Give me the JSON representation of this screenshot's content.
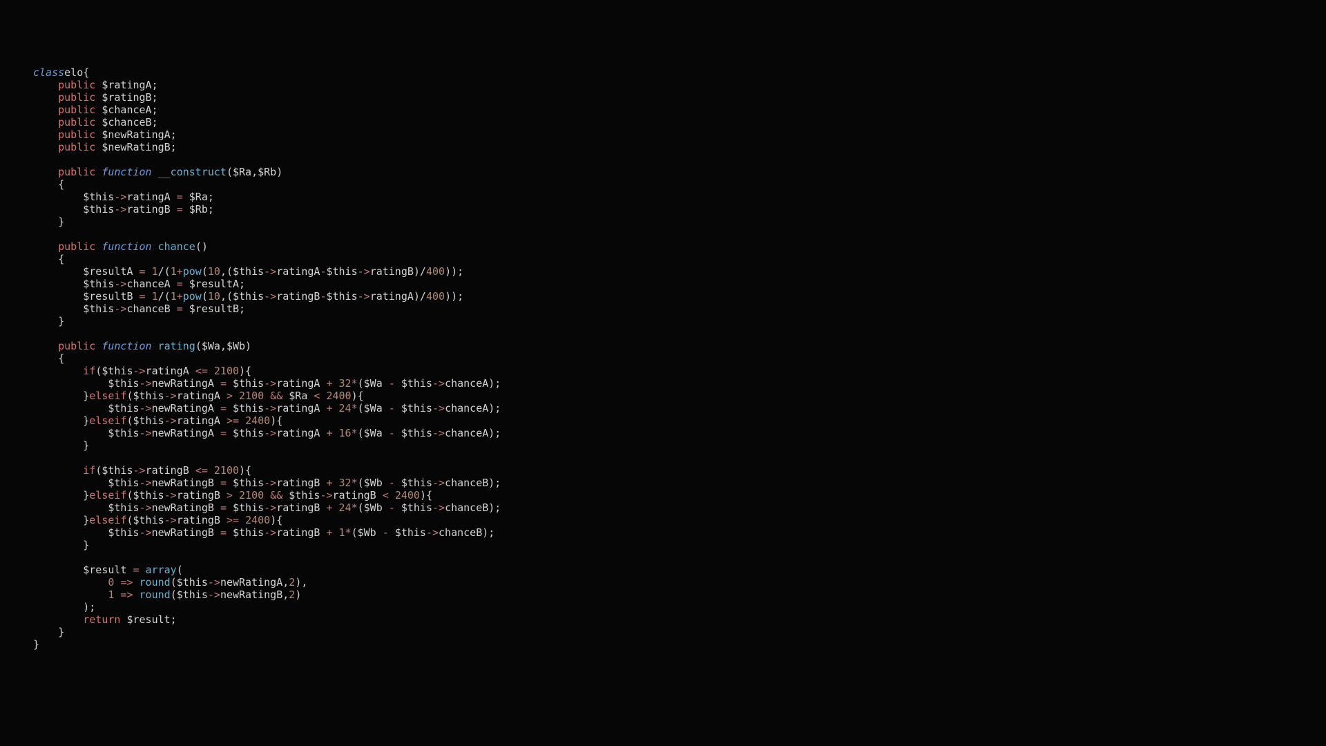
{
  "code_lines": [
    [
      [
        "it",
        "class"
      ],
      [
        "",
        ""
      ],
      [
        "",
        "elo{"
      ]
    ],
    [
      [
        "",
        "    "
      ],
      [
        "kw",
        "public"
      ],
      [
        "",
        " $ratingA;"
      ]
    ],
    [
      [
        "",
        "    "
      ],
      [
        "kw",
        "public"
      ],
      [
        "",
        " $ratingB;"
      ]
    ],
    [
      [
        "",
        "    "
      ],
      [
        "kw",
        "public"
      ],
      [
        "",
        " $chanceA;"
      ]
    ],
    [
      [
        "",
        "    "
      ],
      [
        "kw",
        "public"
      ],
      [
        "",
        " $chanceB;"
      ]
    ],
    [
      [
        "",
        "    "
      ],
      [
        "kw",
        "public"
      ],
      [
        "",
        " $newRatingA;"
      ]
    ],
    [
      [
        "",
        "    "
      ],
      [
        "kw",
        "public"
      ],
      [
        "",
        " $newRatingB;"
      ]
    ],
    [
      [
        "",
        ""
      ]
    ],
    [
      [
        "",
        "    "
      ],
      [
        "kw",
        "public"
      ],
      [
        "",
        " "
      ],
      [
        "it",
        "function"
      ],
      [
        "",
        " "
      ],
      [
        "fn",
        "__construct"
      ],
      [
        "",
        "($Ra,$Rb)"
      ]
    ],
    [
      [
        "",
        "    {"
      ]
    ],
    [
      [
        "",
        "        $this"
      ],
      [
        "op",
        "->"
      ],
      [
        "",
        "ratingA "
      ],
      [
        "op",
        "="
      ],
      [
        "",
        " $Ra;"
      ]
    ],
    [
      [
        "",
        "        $this"
      ],
      [
        "op",
        "->"
      ],
      [
        "",
        "ratingB "
      ],
      [
        "op",
        "="
      ],
      [
        "",
        " $Rb;"
      ]
    ],
    [
      [
        "",
        "    }"
      ]
    ],
    [
      [
        "",
        ""
      ]
    ],
    [
      [
        "",
        "    "
      ],
      [
        "kw",
        "public"
      ],
      [
        "",
        " "
      ],
      [
        "it",
        "function"
      ],
      [
        "",
        " "
      ],
      [
        "fn",
        "chance"
      ],
      [
        "",
        "()"
      ]
    ],
    [
      [
        "",
        "    {"
      ]
    ],
    [
      [
        "",
        "        $resultA "
      ],
      [
        "op",
        "="
      ],
      [
        "",
        " "
      ],
      [
        "num",
        "1"
      ],
      [
        "",
        "/("
      ],
      [
        "num",
        "1"
      ],
      [
        "op",
        "+"
      ],
      [
        "fn",
        "pow"
      ],
      [
        "",
        "("
      ],
      [
        "num",
        "10"
      ],
      [
        "",
        ",($this"
      ],
      [
        "op",
        "->"
      ],
      [
        "",
        "ratingA"
      ],
      [
        "op",
        "-"
      ],
      [
        "",
        "$this"
      ],
      [
        "op",
        "->"
      ],
      [
        "",
        "ratingB)/"
      ],
      [
        "num",
        "400"
      ],
      [
        "",
        "));"
      ]
    ],
    [
      [
        "",
        "        $this"
      ],
      [
        "op",
        "->"
      ],
      [
        "",
        "chanceA "
      ],
      [
        "op",
        "="
      ],
      [
        "",
        " $resultA;"
      ]
    ],
    [
      [
        "",
        "        $resultB "
      ],
      [
        "op",
        "="
      ],
      [
        "",
        " "
      ],
      [
        "num",
        "1"
      ],
      [
        "",
        "/("
      ],
      [
        "num",
        "1"
      ],
      [
        "op",
        "+"
      ],
      [
        "fn",
        "pow"
      ],
      [
        "",
        "("
      ],
      [
        "num",
        "10"
      ],
      [
        "",
        ",($this"
      ],
      [
        "op",
        "->"
      ],
      [
        "",
        "ratingB"
      ],
      [
        "op",
        "-"
      ],
      [
        "",
        "$this"
      ],
      [
        "op",
        "->"
      ],
      [
        "",
        "ratingA)/"
      ],
      [
        "num",
        "400"
      ],
      [
        "",
        "));"
      ]
    ],
    [
      [
        "",
        "        $this"
      ],
      [
        "op",
        "->"
      ],
      [
        "",
        "chanceB "
      ],
      [
        "op",
        "="
      ],
      [
        "",
        " $resultB;"
      ]
    ],
    [
      [
        "",
        "    }"
      ]
    ],
    [
      [
        "",
        ""
      ]
    ],
    [
      [
        "",
        "    "
      ],
      [
        "kw",
        "public"
      ],
      [
        "",
        " "
      ],
      [
        "it",
        "function"
      ],
      [
        "",
        " "
      ],
      [
        "fn",
        "rating"
      ],
      [
        "",
        "($Wa,$Wb)"
      ]
    ],
    [
      [
        "",
        "    {"
      ]
    ],
    [
      [
        "",
        "        "
      ],
      [
        "kw",
        "if"
      ],
      [
        "",
        "($this"
      ],
      [
        "op",
        "->"
      ],
      [
        "",
        "ratingA "
      ],
      [
        "op",
        "<="
      ],
      [
        "",
        " "
      ],
      [
        "num",
        "2100"
      ],
      [
        "",
        "){"
      ]
    ],
    [
      [
        "",
        "            $this"
      ],
      [
        "op",
        "->"
      ],
      [
        "",
        "newRatingA "
      ],
      [
        "op",
        "="
      ],
      [
        "",
        " $this"
      ],
      [
        "op",
        "->"
      ],
      [
        "",
        "ratingA "
      ],
      [
        "op",
        "+"
      ],
      [
        "",
        " "
      ],
      [
        "num",
        "32"
      ],
      [
        "op",
        "*"
      ],
      [
        "",
        "($Wa "
      ],
      [
        "op",
        "-"
      ],
      [
        "",
        " $this"
      ],
      [
        "op",
        "->"
      ],
      [
        "",
        "chanceA);"
      ]
    ],
    [
      [
        "",
        "        }"
      ],
      [
        "kw",
        "elseif"
      ],
      [
        "",
        "($this"
      ],
      [
        "op",
        "->"
      ],
      [
        "",
        "ratingA "
      ],
      [
        "op",
        ">"
      ],
      [
        "",
        " "
      ],
      [
        "num",
        "2100"
      ],
      [
        "",
        " "
      ],
      [
        "op",
        "&&"
      ],
      [
        "",
        " $Ra "
      ],
      [
        "op",
        "<"
      ],
      [
        "",
        " "
      ],
      [
        "num",
        "2400"
      ],
      [
        "",
        "){"
      ]
    ],
    [
      [
        "",
        "            $this"
      ],
      [
        "op",
        "->"
      ],
      [
        "",
        "newRatingA "
      ],
      [
        "op",
        "="
      ],
      [
        "",
        " $this"
      ],
      [
        "op",
        "->"
      ],
      [
        "",
        "ratingA "
      ],
      [
        "op",
        "+"
      ],
      [
        "",
        " "
      ],
      [
        "num",
        "24"
      ],
      [
        "op",
        "*"
      ],
      [
        "",
        "($Wa "
      ],
      [
        "op",
        "-"
      ],
      [
        "",
        " $this"
      ],
      [
        "op",
        "->"
      ],
      [
        "",
        "chanceA);"
      ]
    ],
    [
      [
        "",
        "        }"
      ],
      [
        "kw",
        "elseif"
      ],
      [
        "",
        "($this"
      ],
      [
        "op",
        "->"
      ],
      [
        "",
        "ratingA "
      ],
      [
        "op",
        ">="
      ],
      [
        "",
        " "
      ],
      [
        "num",
        "2400"
      ],
      [
        "",
        "){"
      ]
    ],
    [
      [
        "",
        "            $this"
      ],
      [
        "op",
        "->"
      ],
      [
        "",
        "newRatingA "
      ],
      [
        "op",
        "="
      ],
      [
        "",
        " $this"
      ],
      [
        "op",
        "->"
      ],
      [
        "",
        "ratingA "
      ],
      [
        "op",
        "+"
      ],
      [
        "",
        " "
      ],
      [
        "num",
        "16"
      ],
      [
        "op",
        "*"
      ],
      [
        "",
        "($Wa "
      ],
      [
        "op",
        "-"
      ],
      [
        "",
        " $this"
      ],
      [
        "op",
        "->"
      ],
      [
        "",
        "chanceA);"
      ]
    ],
    [
      [
        "",
        "        }"
      ]
    ],
    [
      [
        "",
        ""
      ]
    ],
    [
      [
        "",
        "        "
      ],
      [
        "kw",
        "if"
      ],
      [
        "",
        "($this"
      ],
      [
        "op",
        "->"
      ],
      [
        "",
        "ratingB "
      ],
      [
        "op",
        "<="
      ],
      [
        "",
        " "
      ],
      [
        "num",
        "2100"
      ],
      [
        "",
        "){"
      ]
    ],
    [
      [
        "",
        "            $this"
      ],
      [
        "op",
        "->"
      ],
      [
        "",
        "newRatingB "
      ],
      [
        "op",
        "="
      ],
      [
        "",
        " $this"
      ],
      [
        "op",
        "->"
      ],
      [
        "",
        "ratingB "
      ],
      [
        "op",
        "+"
      ],
      [
        "",
        " "
      ],
      [
        "num",
        "32"
      ],
      [
        "op",
        "*"
      ],
      [
        "",
        "($Wb "
      ],
      [
        "op",
        "-"
      ],
      [
        "",
        " $this"
      ],
      [
        "op",
        "->"
      ],
      [
        "",
        "chanceB);"
      ]
    ],
    [
      [
        "",
        "        }"
      ],
      [
        "kw",
        "elseif"
      ],
      [
        "",
        "($this"
      ],
      [
        "op",
        "->"
      ],
      [
        "",
        "ratingB "
      ],
      [
        "op",
        ">"
      ],
      [
        "",
        " "
      ],
      [
        "num",
        "2100"
      ],
      [
        "",
        " "
      ],
      [
        "op",
        "&&"
      ],
      [
        "",
        " $this"
      ],
      [
        "op",
        "->"
      ],
      [
        "",
        "ratingB "
      ],
      [
        "op",
        "<"
      ],
      [
        "",
        " "
      ],
      [
        "num",
        "2400"
      ],
      [
        "",
        "){"
      ]
    ],
    [
      [
        "",
        "            $this"
      ],
      [
        "op",
        "->"
      ],
      [
        "",
        "newRatingB "
      ],
      [
        "op",
        "="
      ],
      [
        "",
        " $this"
      ],
      [
        "op",
        "->"
      ],
      [
        "",
        "ratingB "
      ],
      [
        "op",
        "+"
      ],
      [
        "",
        " "
      ],
      [
        "num",
        "24"
      ],
      [
        "op",
        "*"
      ],
      [
        "",
        "($Wb "
      ],
      [
        "op",
        "-"
      ],
      [
        "",
        " $this"
      ],
      [
        "op",
        "->"
      ],
      [
        "",
        "chanceB);"
      ]
    ],
    [
      [
        "",
        "        }"
      ],
      [
        "kw",
        "elseif"
      ],
      [
        "",
        "($this"
      ],
      [
        "op",
        "->"
      ],
      [
        "",
        "ratingB "
      ],
      [
        "op",
        ">="
      ],
      [
        "",
        " "
      ],
      [
        "num",
        "2400"
      ],
      [
        "",
        "){"
      ]
    ],
    [
      [
        "",
        "            $this"
      ],
      [
        "op",
        "->"
      ],
      [
        "",
        "newRatingB "
      ],
      [
        "op",
        "="
      ],
      [
        "",
        " $this"
      ],
      [
        "op",
        "->"
      ],
      [
        "",
        "ratingB "
      ],
      [
        "op",
        "+"
      ],
      [
        "",
        " "
      ],
      [
        "num",
        "1"
      ],
      [
        "op",
        "*"
      ],
      [
        "",
        "($Wb "
      ],
      [
        "op",
        "-"
      ],
      [
        "",
        " $this"
      ],
      [
        "op",
        "->"
      ],
      [
        "",
        "chanceB);"
      ]
    ],
    [
      [
        "",
        "        }"
      ]
    ],
    [
      [
        "",
        ""
      ]
    ],
    [
      [
        "",
        "        $result "
      ],
      [
        "op",
        "="
      ],
      [
        "",
        " "
      ],
      [
        "fn",
        "array"
      ],
      [
        "",
        "("
      ]
    ],
    [
      [
        "",
        "            "
      ],
      [
        "num",
        "0"
      ],
      [
        "",
        " "
      ],
      [
        "op",
        "=>"
      ],
      [
        "",
        " "
      ],
      [
        "fn",
        "round"
      ],
      [
        "",
        "($this"
      ],
      [
        "op",
        "->"
      ],
      [
        "",
        "newRatingA,"
      ],
      [
        "num",
        "2"
      ],
      [
        "",
        "),"
      ]
    ],
    [
      [
        "",
        "            "
      ],
      [
        "num",
        "1"
      ],
      [
        "",
        " "
      ],
      [
        "op",
        "=>"
      ],
      [
        "",
        " "
      ],
      [
        "fn",
        "round"
      ],
      [
        "",
        "($this"
      ],
      [
        "op",
        "->"
      ],
      [
        "",
        "newRatingB,"
      ],
      [
        "num",
        "2"
      ],
      [
        "",
        ")"
      ]
    ],
    [
      [
        "",
        "        );"
      ]
    ],
    [
      [
        "",
        "        "
      ],
      [
        "kw",
        "return"
      ],
      [
        "",
        " $result;"
      ]
    ],
    [
      [
        "",
        "    }"
      ]
    ],
    [
      [
        "",
        "}"
      ]
    ]
  ]
}
